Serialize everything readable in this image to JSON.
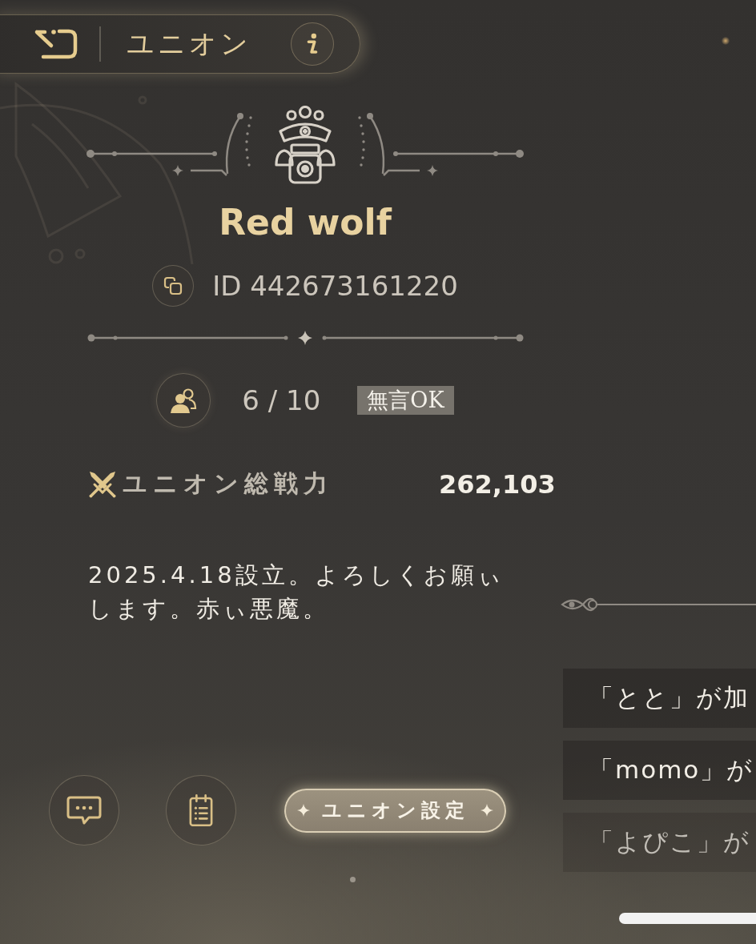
{
  "header": {
    "title": "ユニオン"
  },
  "union": {
    "name": "Red wolf",
    "id": "ID 442673161220",
    "members": "6 / 10",
    "tag": "無言OK",
    "power_label": "ユニオン総戦力",
    "power_value": "262,103",
    "description": "2025.4.18設立。よろしくお願ぃします。赤ぃ悪魔。"
  },
  "activity_log": [
    {
      "text": "「とと」が加"
    },
    {
      "text": "「momo」が"
    },
    {
      "text": "「よぴこ」が"
    }
  ],
  "actions": {
    "settings_label": "ユニオン設定"
  }
}
